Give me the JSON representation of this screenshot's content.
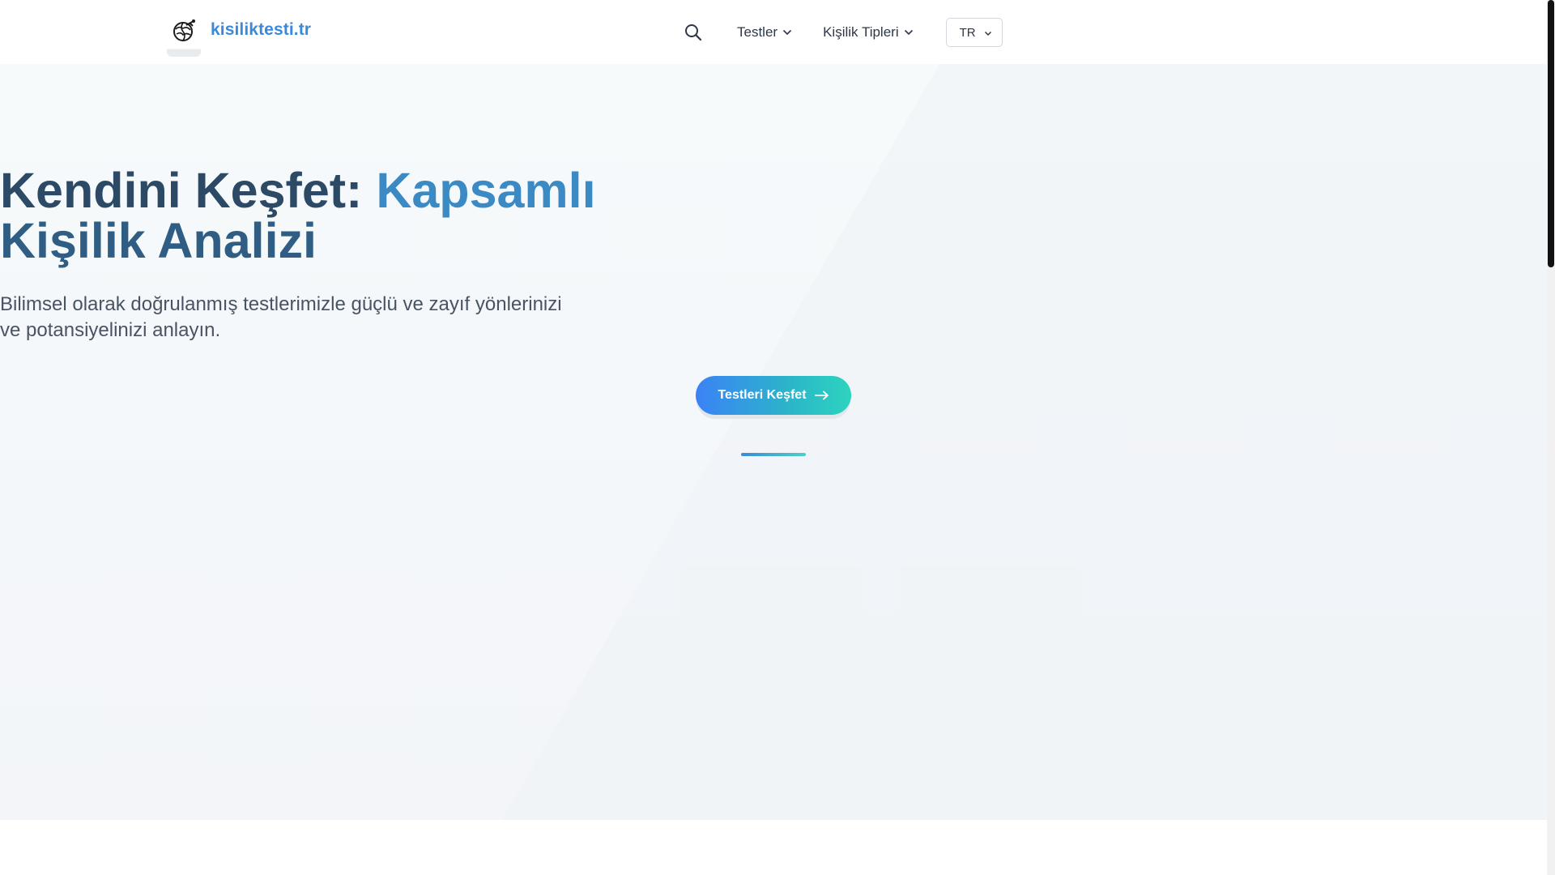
{
  "header": {
    "logo_text": "kisiliktesti.tr",
    "logo_icon": "brain-globe-icon",
    "nav": {
      "tests_label": "Testler",
      "types_label": "Kişilik Tipleri",
      "language": "TR"
    }
  },
  "hero": {
    "title_part1": "Kendini Keşfet: ",
    "title_part2": "Kapsamlı",
    "title_line2": "Kişilik Analizi",
    "subtitle_line1": "Bilimsel olarak doğrulanmış testlerimizle güçlü ve zayıf yönlerinizi",
    "subtitle_line2": "ve potansiyelinizi anlayın.",
    "cta_label": "Testleri Keşfet"
  },
  "colors": {
    "brand": "#3b8ad9",
    "title_dark": "#2c4a66",
    "title_accent": "#3b8ac4",
    "cta_start": "#3b82f6",
    "cta_end": "#2dd4bf"
  }
}
